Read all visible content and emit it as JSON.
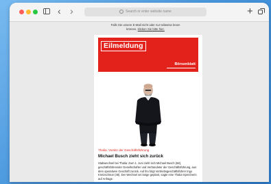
{
  "browser": {
    "address_placeholder": "Search or enter website name",
    "back_icon": "chevron-left-icon",
    "forward_icon": "chevron-right-icon",
    "new_tab_icon": "plus-icon",
    "tabs_overview_icon": "tabs-overview-icon",
    "sidebar_icon": "sidebar-icon"
  },
  "page": {
    "notice_line1": "Falls Sie unsere E-Mail nicht oder nur teilweise lesen",
    "notice_line2_prefix": "können, ",
    "notice_link": "klicken Sie bitte hier.",
    "banner_title": "Eilmeldung",
    "brand": "Börsenblatt",
    "kicker": "Thalia: Vorsitz der Geschäftsführung",
    "headline": "Michael Busch zieht sich zurück",
    "body": "Stabwechsel bei Thalia: Zum 1. Juni zieht sich Michael Busch (68), geschäftsführender Gesellschafter und Verbündeter der Geschäftsführung, aus dem operativen Geschäft zurück. Auf ihn folgt Vertriebsgeschäftsführer Ingo Kretzschmar (48). Der Wechsel sei lange geplant, sagte eine Thalia-Sprecherin auf Anfrage."
  },
  "colors": {
    "accent_red": "#e3231b",
    "background_blue": "#4a97dd"
  }
}
